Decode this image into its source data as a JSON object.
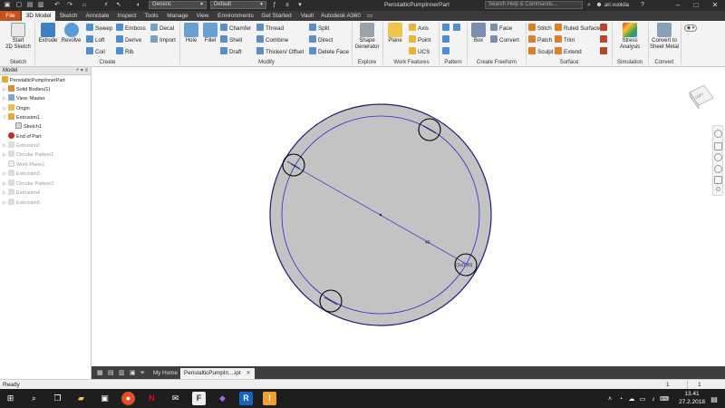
{
  "titlebar": {
    "material_combo": "Generic",
    "appearance_combo": "Default",
    "doc_title": "PeristalticPumpInnerPart",
    "search_placeholder": "Search Help & Commands...",
    "user": "ari.vuokila",
    "minimize": "–",
    "maximize": "□",
    "close": "✕"
  },
  "tabs": [
    "File",
    "3D Model",
    "Sketch",
    "Annotate",
    "Inspect",
    "Tools",
    "Manage",
    "View",
    "Environments",
    "Get Started",
    "Vault",
    "Autodesk A360"
  ],
  "ribbon": {
    "sketch_panel": {
      "label": "Sketch",
      "start_sketch": "Start",
      "start_sketch_2": "2D Sketch"
    },
    "create_panel": {
      "label": "Create",
      "extrude": "Extrude",
      "revolve": "Revolve",
      "sweep": "Sweep",
      "loft": "Loft",
      "coil": "Coil",
      "emboss": "Emboss",
      "derive": "Derive",
      "rib": "Rib",
      "decal": "Decal",
      "import": "Import"
    },
    "modify_panel": {
      "label": "Modify",
      "hole": "Hole",
      "fillet": "Fillet",
      "chamfer": "Chamfer",
      "shell": "Shell",
      "draft": "Draft",
      "thread": "Thread",
      "combine": "Combine",
      "thicken": "Thicken/ Offset",
      "split": "Split",
      "direct": "Direct",
      "delete_face": "Delete Face"
    },
    "explore_panel": {
      "label": "Explore",
      "shape_generator": "Shape",
      "shape_generator_2": "Generator"
    },
    "work_panel": {
      "label": "Work Features",
      "plane": "Plane",
      "axis": "Axis",
      "point": "Point",
      "ucs": "UCS"
    },
    "pattern_panel": {
      "label": "Pattern"
    },
    "freeform_panel": {
      "label": "Create Freeform",
      "box": "Box",
      "face": "Face",
      "convert": "Convert"
    },
    "surface_panel": {
      "label": "Surface",
      "stitch": "Stitch",
      "patch": "Patch",
      "sculpt": "Sculpt",
      "ruled_surface": "Ruled Surface",
      "trim": "Trim",
      "extend": "Extend"
    },
    "simulation_panel": {
      "label": "Simulation",
      "stress": "Stress",
      "stress_2": "Analysis"
    },
    "convert_panel": {
      "label": "Convert",
      "sheet_metal": "Convert to",
      "sheet_metal_2": "Sheet Metal"
    }
  },
  "browser": {
    "title": "Model",
    "tools": "+ ▾  ≡",
    "items": [
      {
        "label": "PeristalticPumpInnerPart"
      },
      {
        "label": "Solid Bodies(1)"
      },
      {
        "label": "View: Master"
      },
      {
        "label": "Origin"
      },
      {
        "label": "Extrusion1"
      },
      {
        "label": "Sketch1"
      },
      {
        "label": "End of Part"
      },
      {
        "label": "Extrusion2"
      },
      {
        "label": "Circular Pattern1"
      },
      {
        "label": "Work Plane1"
      },
      {
        "label": "Extrusion3"
      },
      {
        "label": "Circular Pattern2"
      },
      {
        "label": "Extrusion4"
      },
      {
        "label": "Extrusion5"
      }
    ]
  },
  "canvas": {
    "dim_label": "40",
    "dim_label_2": "(3x0.00)",
    "viewcube_label": "LEFT"
  },
  "doctabs": {
    "home": "My Home",
    "active": "PeristalticPumpIn....ipt"
  },
  "statusbar": {
    "text": "Ready",
    "count1": "1",
    "count2": "1"
  },
  "taskbar": {
    "time": "13.41",
    "date": "27.2.2018"
  }
}
